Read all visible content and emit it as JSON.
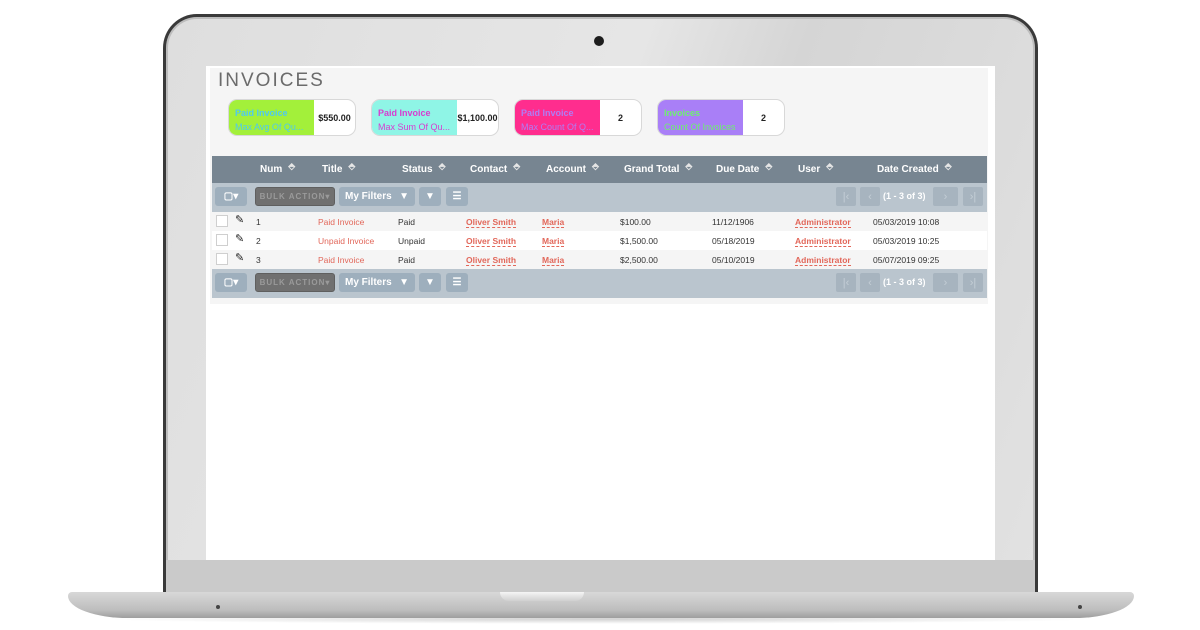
{
  "page": {
    "title": "INVOICES"
  },
  "dashlets": [
    {
      "line1": "Paid Invoice",
      "line2": "Max Avg Of Qu...",
      "value": "$550.00",
      "bg": "#a3f03a",
      "color1": "#4fc8f0",
      "color2": "#4fc8f0"
    },
    {
      "line1": "Paid Invoice",
      "line2": "Max Sum Of Qu...",
      "value": "$1,100.00",
      "bg": "#8ff5e6",
      "color1": "#d83cd0",
      "color2": "#d83cd0"
    },
    {
      "line1": "Paid Invoice",
      "line2": "Max Count Of Q...",
      "value": "2",
      "bg": "#ff2d8e",
      "color1": "#b07cf5",
      "color2": "#b07cf5"
    },
    {
      "line1": "Invoices",
      "line2": "Count Of Invoices",
      "value": "2",
      "bg": "#a97ff7",
      "color1": "#6ef06e",
      "color2": "#6ef06e"
    }
  ],
  "table": {
    "columns": [
      "Num",
      "Title",
      "Status",
      "Contact",
      "Account",
      "Grand Total",
      "Due Date",
      "User",
      "Date Created"
    ],
    "rows": [
      {
        "num": "1",
        "title": "Paid Invoice",
        "status": "Paid",
        "contact": "Oliver Smith",
        "account": "Maria",
        "grand_total": "$100.00",
        "due_date": "11/12/1906",
        "user": "Administrator",
        "date_created": "05/03/2019 10:08"
      },
      {
        "num": "2",
        "title": "Unpaid Invoice",
        "status": "Unpaid",
        "contact": "Oliver Smith",
        "account": "Maria",
        "grand_total": "$1,500.00",
        "due_date": "05/18/2019",
        "user": "Administrator",
        "date_created": "05/03/2019 10:25"
      },
      {
        "num": "3",
        "title": "Paid Invoice",
        "status": "Paid",
        "contact": "Oliver Smith",
        "account": "Maria",
        "grand_total": "$2,500.00",
        "due_date": "05/10/2019",
        "user": "Administrator",
        "date_created": "05/07/2019 09:25"
      }
    ]
  },
  "toolbar": {
    "select_icon": "checkbox-dropdown-icon",
    "bulk_action": "BULK ACTION",
    "my_filters": "My Filters",
    "filter_icon": "filter-icon",
    "columns_icon": "list-icon",
    "pagination": "(1 - 3 of 3)",
    "first": "|‹",
    "prev": "‹",
    "next": "›",
    "last": "›|"
  },
  "icons": {
    "sort": "⬘",
    "edit": "✎",
    "caret": "▾"
  }
}
